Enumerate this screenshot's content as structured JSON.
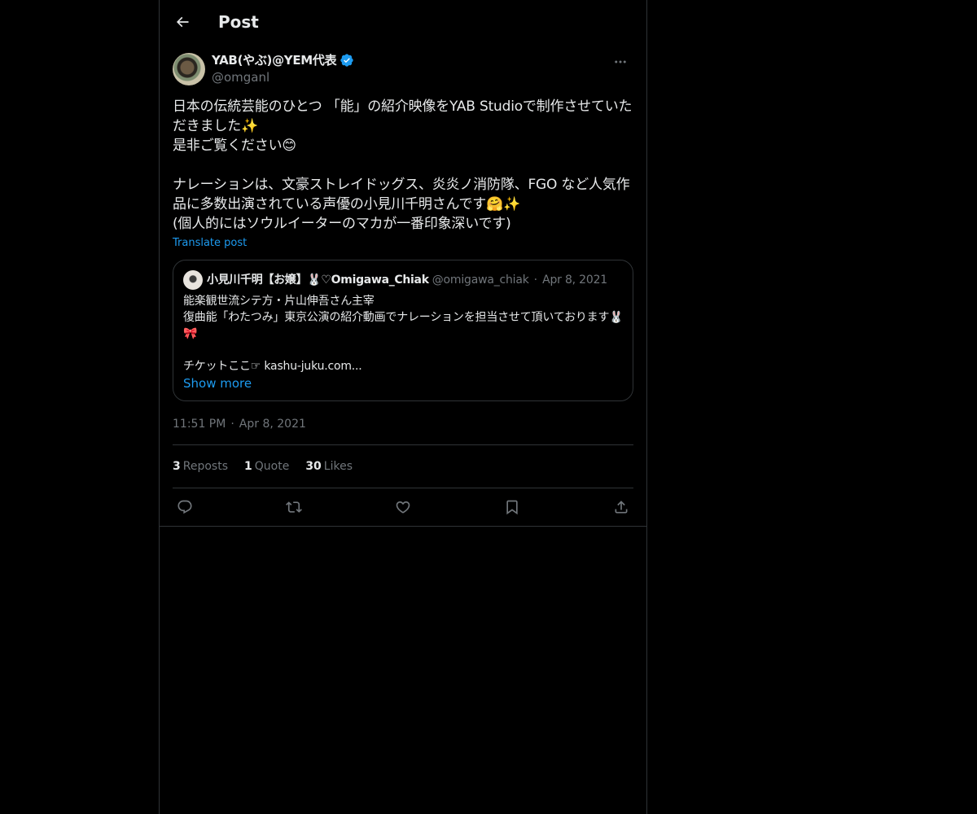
{
  "header": {
    "title": "Post",
    "back_icon": "arrow-left-icon"
  },
  "author": {
    "display_name": "YAB(やぶ)@YEM代表",
    "handle": "@omganl",
    "verified": true,
    "verified_color": "#1d9bf0"
  },
  "post": {
    "text": "日本の伝統芸能のひとつ 「能」の紹介映像をYAB Studioで制作させていただきました✨\n是非ご覧ください😊\n\nナレーションは、文豪ストレイドッグス、炎炎ノ消防隊、FGO など人気作品に多数出演されている声優の小見川千明さんです🤗✨\n(個人的にはソウルイーターのマカが一番印象深いです)",
    "translate_label": "Translate post",
    "time": "11:51 PM",
    "date": "Apr 8, 2021"
  },
  "quote": {
    "display_name": "小見川千明【お嬢】🐰♡Omigawa_Chiak",
    "handle": "@omigawa_chiak",
    "date": "Apr 8, 2021",
    "text": "能楽観世流シテ方・片山伸吾さん主宰\n復曲能「わたつみ」東京公演の紹介動画でナレーションを担当させて頂いております🐰🎀\n\nチケットここ☞ kashu-juku.com...",
    "show_more_label": "Show more"
  },
  "stats": {
    "reposts_count": "3",
    "reposts_label": "Reposts",
    "quotes_count": "1",
    "quotes_label": "Quote",
    "likes_count": "30",
    "likes_label": "Likes"
  },
  "colors": {
    "background": "#000000",
    "text": "#e7e9ea",
    "muted": "#71767b",
    "border": "#2f3336",
    "accent": "#1d9bf0"
  }
}
